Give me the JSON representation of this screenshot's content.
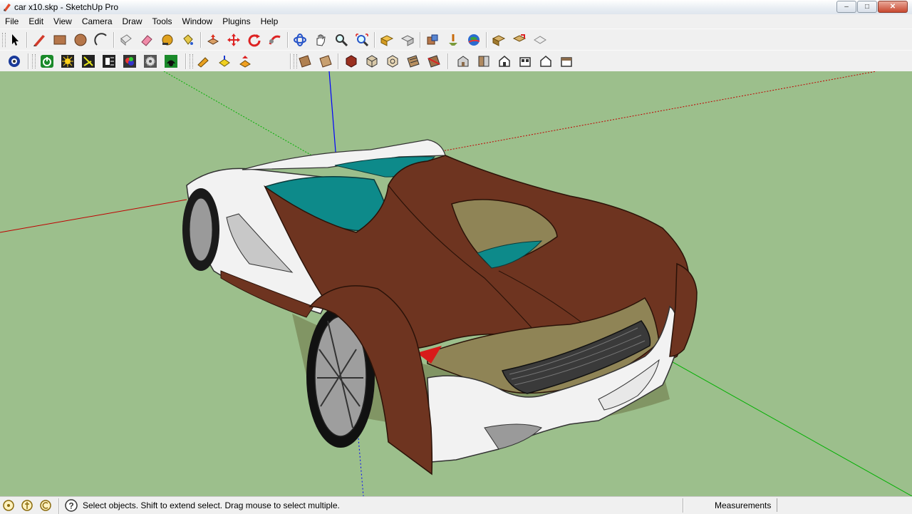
{
  "window": {
    "title": "car x10.skp - SketchUp Pro",
    "minimize_glyph": "–",
    "maximize_glyph": "□",
    "close_glyph": "✕"
  },
  "menu": [
    "File",
    "Edit",
    "View",
    "Camera",
    "Draw",
    "Tools",
    "Window",
    "Plugins",
    "Help"
  ],
  "toolbar_primary": [
    "select-icon",
    "pencil-line-icon",
    "rectangle-icon",
    "circle-icon",
    "arc-icon",
    "make-component-icon",
    "eraser-icon",
    "tape-measure-icon",
    "paint-bucket-icon",
    "push-pull-icon",
    "move-icon",
    "rotate-icon",
    "follow-me-icon",
    "orbit-icon",
    "pan-icon",
    "zoom-icon",
    "zoom-extents-icon",
    "get-models-icon",
    "share-model-icon",
    "get-photo-texture-icon",
    "add-location-icon",
    "google-earth-icon",
    "preview-model-icon",
    "share-component-icon",
    "layer-icon"
  ],
  "toolbar_secondary": [
    "3d-connexion-icon",
    "power-icon",
    "sun-shadows-icon",
    "fog-icon",
    "section-cut-icon",
    "color-settings-icon",
    "gear-settings-icon",
    "render-icon",
    "plugin-tool-a-icon",
    "plugin-tool-b-icon",
    "plugin-tool-c-icon",
    "face-style-a-icon",
    "face-style-b-icon",
    "x-ray-icon",
    "wireframe-box-icon",
    "hidden-line-icon",
    "shaded-icon",
    "shaded-texture-icon",
    "monochrome-icon",
    "iso-view-icon",
    "top-view-icon",
    "front-view-icon",
    "right-view-icon",
    "back-view-icon",
    "left-view-icon"
  ],
  "status": {
    "message": "Select objects. Shift to extend select. Drag mouse to select multiple.",
    "measurements_label": "Measurements",
    "measurements_value": ""
  },
  "colors": {
    "ground": "#9cbf8c",
    "body_brown": "#6e3420",
    "body_white": "#f2f2f2",
    "glass_teal": "#0d8a8a",
    "olive": "#8f8456",
    "axis_red": "#c00000",
    "axis_green": "#00b000",
    "axis_blue": "#0000ff"
  }
}
